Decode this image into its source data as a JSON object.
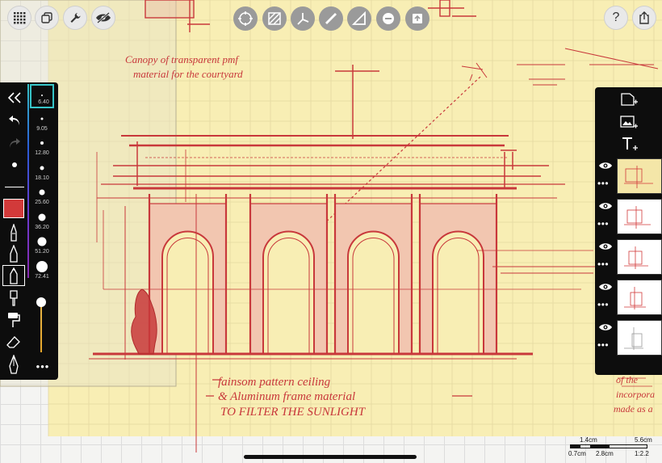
{
  "toolbar_left": {
    "grid_menu": "grid-menu",
    "layers_stack": "layers-stack",
    "settings": "wrench",
    "visibility": "eye-slash"
  },
  "toolbar_center": [
    "transform",
    "hatch-fill",
    "axis-guide",
    "ruler",
    "set-square",
    "minus-circle",
    "import"
  ],
  "toolbar_right": {
    "help_label": "?",
    "share": "share"
  },
  "drawing": {
    "note_top_line1": "Canopy of transparent pmf",
    "note_top_line2": "material for the courtyard",
    "note_bottom_line1": "fainsom pattern ceiling",
    "note_bottom_line2": "& Aluminum frame material",
    "note_bottom_line3": "TO FILTER THE SUNLIGHT",
    "note_right_line1": "of the",
    "note_right_line2": "incorpora",
    "note_right_line3": "made as a"
  },
  "brush_sizes": [
    {
      "label": "6.40"
    },
    {
      "label": "9.05"
    },
    {
      "label": "12.80"
    },
    {
      "label": "18.10"
    },
    {
      "label": "25.60"
    },
    {
      "label": "36.20"
    },
    {
      "label": "51.20"
    },
    {
      "label": "72.41"
    }
  ],
  "colors": {
    "active": "#d23a3a",
    "ink": "#c8383b",
    "paper": "#f8eeb4",
    "palette_bg": "#0d0d0d",
    "highlight": "#37c5c8"
  },
  "more_label": "•••",
  "layers_panel": {
    "layer_count": 5
  },
  "scale_bar": {
    "top_left": "1.4cm",
    "top_right": "5.6cm",
    "bottom_left": "0.7cm",
    "bottom_mid": "2.8cm",
    "ratio": "1:2.2"
  }
}
